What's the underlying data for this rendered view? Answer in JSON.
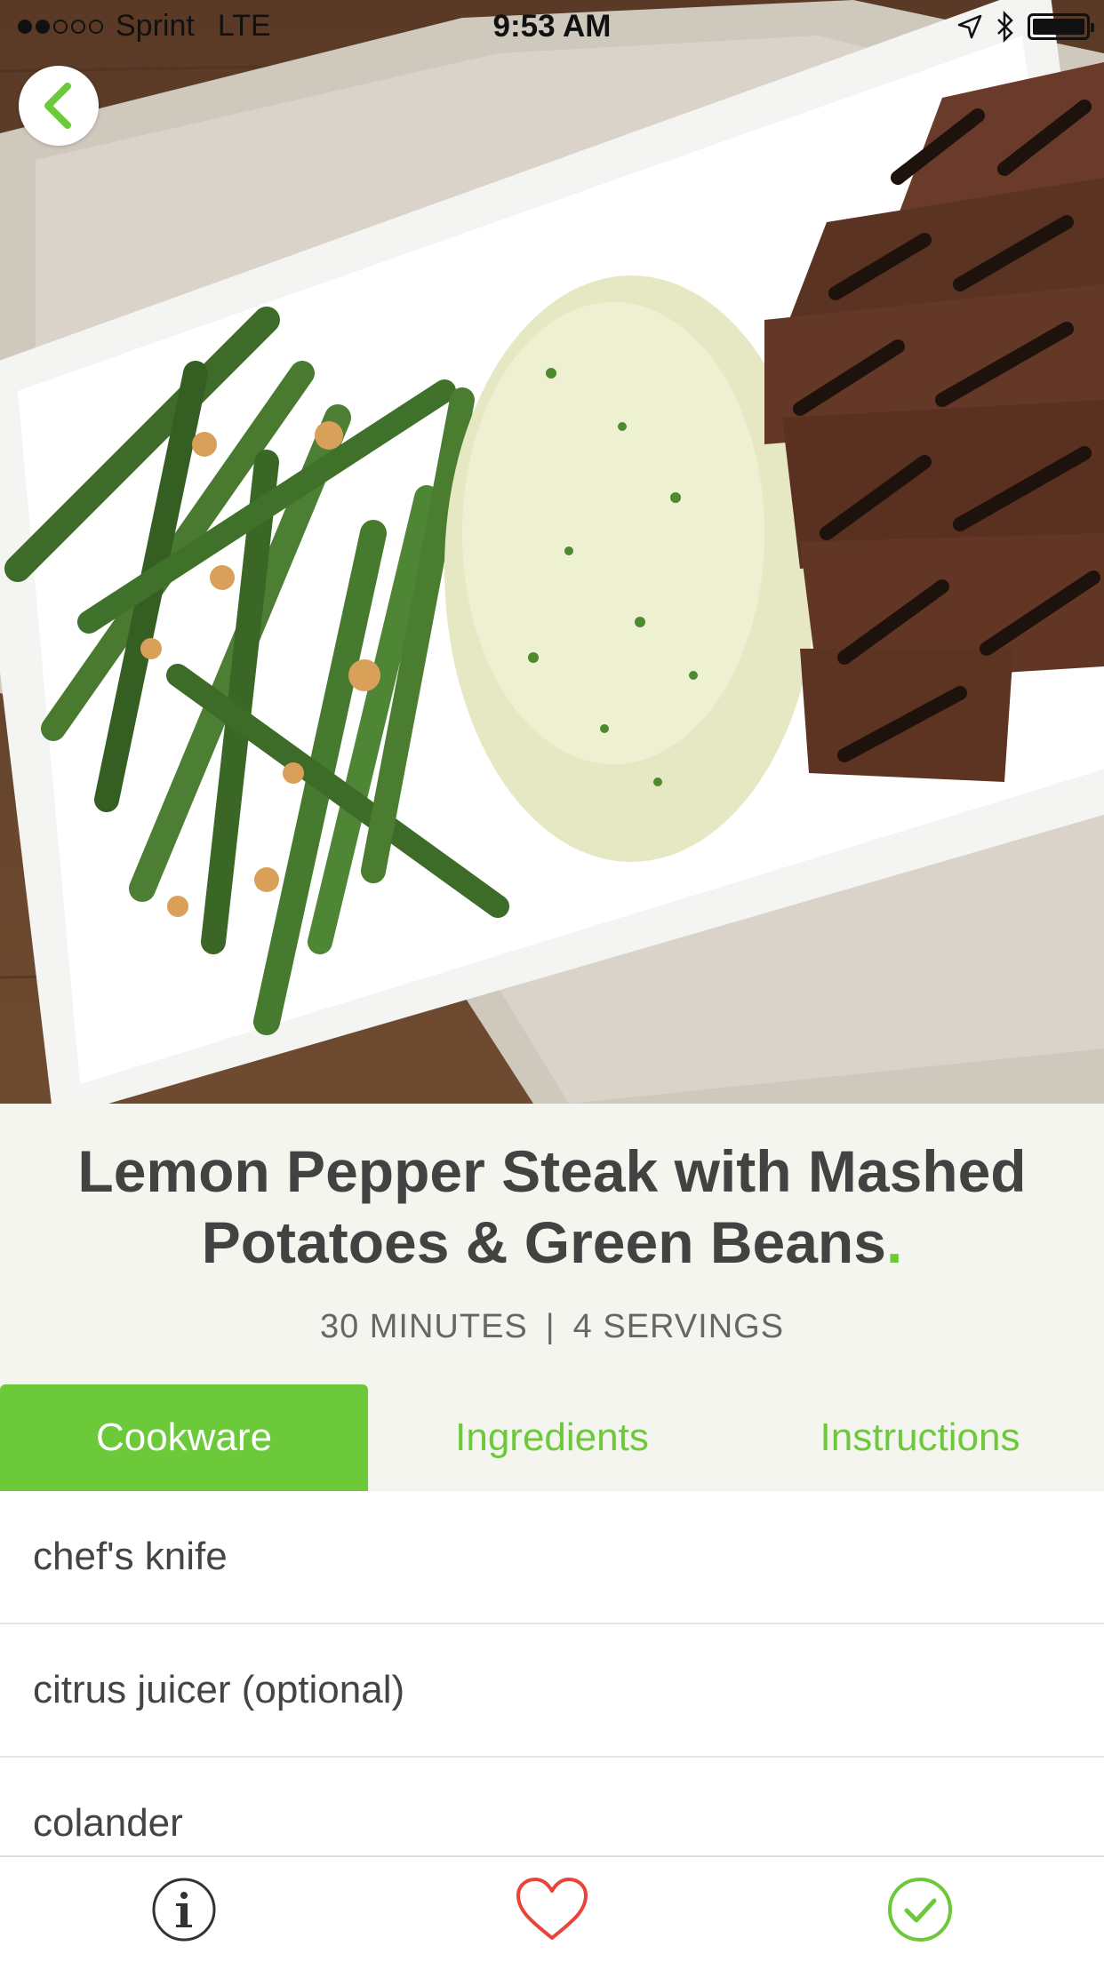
{
  "status_bar": {
    "carrier": "Sprint",
    "network": "LTE",
    "time": "9:53 AM",
    "signal_dots": [
      true,
      true,
      false,
      false,
      false
    ]
  },
  "nav": {
    "back_icon": "chevron-left-icon"
  },
  "recipe": {
    "title": "Lemon Pepper Steak with Mashed Potatoes & Green Beans",
    "title_dot": ".",
    "time": "30 MINUTES",
    "separator": "|",
    "servings": "4 SERVINGS"
  },
  "tabs": [
    {
      "label": "Cookware",
      "active": true
    },
    {
      "label": "Ingredients",
      "active": false
    },
    {
      "label": "Instructions",
      "active": false
    }
  ],
  "cookware": [
    "chef's knife",
    "citrus juicer (optional)",
    "colander"
  ],
  "toolbar": {
    "icons": [
      "info-icon",
      "heart-icon",
      "check-circle-icon"
    ]
  },
  "colors": {
    "accent": "#6bc93a",
    "heart": "#e8443a",
    "title": "#424242",
    "background": "#f5f5f0"
  }
}
